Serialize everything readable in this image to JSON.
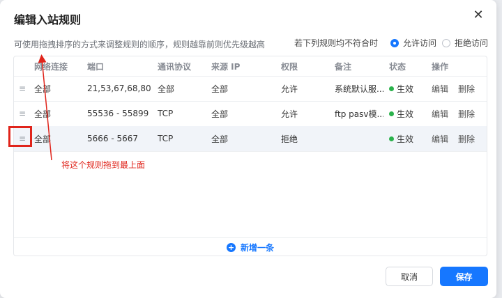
{
  "dialog": {
    "title": "编辑入站规则",
    "close_glyph": "✕",
    "hint": "可使用拖拽排序的方式来调整规则的顺序，规则越靠前则优先级越高"
  },
  "default_policy": {
    "label": "若下列规则均不符合时",
    "options": [
      {
        "label": "允许访问",
        "checked": true
      },
      {
        "label": "拒绝访问",
        "checked": false
      }
    ]
  },
  "table": {
    "headers": {
      "network": "网络连接",
      "port": "端口",
      "protocol": "通讯协议",
      "source": "来源 IP",
      "permission": "权限",
      "note": "备注",
      "status": "状态",
      "actions": "操作"
    },
    "drag_handle_glyph": "≡",
    "rows": [
      {
        "network": "全部",
        "port": "21,53,67,68,80,1...",
        "protocol": "全部",
        "source": "全部",
        "permission": "允许",
        "note": "系统默认服...",
        "status": "生效",
        "edit": "编辑",
        "delete": "删除"
      },
      {
        "network": "全部",
        "port": "55536 - 55899",
        "protocol": "TCP",
        "source": "全部",
        "permission": "允许",
        "note": "ftp pasv模...",
        "status": "生效",
        "edit": "编辑",
        "delete": "删除"
      },
      {
        "network": "全部",
        "port": "5666 - 5667",
        "protocol": "TCP",
        "source": "全部",
        "permission": "拒绝",
        "note": "",
        "status": "生效",
        "edit": "编辑",
        "delete": "删除"
      }
    ],
    "add_label": "新增一条"
  },
  "annotation": {
    "text": "将这个规则拖到最上面",
    "color": "#e0241b"
  },
  "footer": {
    "cancel_label": "取消",
    "save_label": "保存"
  },
  "colors": {
    "accent": "#1677ff",
    "status_active": "#2bb24c"
  }
}
